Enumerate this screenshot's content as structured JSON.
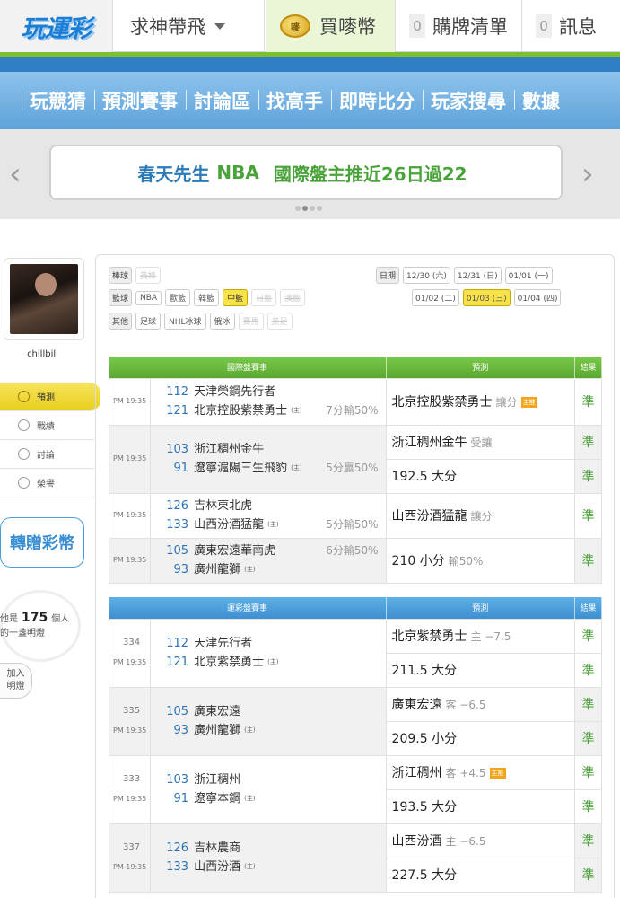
{
  "topbar": {
    "logo": "玩運彩",
    "menu1": "求神帶飛",
    "buy_label": "買嘜幣",
    "coin_label": "嘜",
    "orders_count": "0",
    "orders_label": "購牌清單",
    "msg_count": "0",
    "msg_label": "訊息"
  },
  "nav": [
    "玩競猜",
    "預測賽事",
    "討論區",
    "找高手",
    "即時比分",
    "玩家搜尋",
    "數據"
  ],
  "banner": {
    "left": "春天先生",
    "mid": "NBA",
    "right": "國際盤主推近26日過22",
    "prev": "‹",
    "next": "›"
  },
  "sidebar": {
    "username": "chillbill",
    "menu": [
      "預測",
      "戰績",
      "討論",
      "榮譽"
    ],
    "gift_button": "轉贈彩幣",
    "bulb_prefix": "他是",
    "bulb_count": "175",
    "bulb_suffix": "個人",
    "bulb_line2": "的一盞明燈",
    "join_line1": "加入",
    "join_line2": "明燈"
  },
  "filters": {
    "row1_label": "棒球",
    "row1": [
      "美棒"
    ],
    "row2_label": "籃球",
    "row2": [
      "NBA",
      "歐籃",
      "韓籃",
      "中籃",
      "日籃",
      "澳籃"
    ],
    "row3_label": "其他",
    "row3": [
      "足球",
      "NHL冰球",
      "俄冰",
      "賽馬",
      "美足"
    ],
    "date_label": "日期",
    "dates1": [
      "12/30 (六)",
      "12/31 (日)",
      "01/01 (一)"
    ],
    "dates2": [
      "01/02 (二)",
      "01/03 (三)",
      "01/04 (四)"
    ]
  },
  "intl": {
    "headers": [
      "國際盤賽事",
      "預測",
      "結果"
    ],
    "time": "PM 19:35",
    "home": "(主)",
    "games": [
      {
        "n1": "112",
        "t1": "天津榮鋼先行者",
        "n2": "121",
        "t2": "北京控股紫禁勇士",
        "spread": "7分輸50%",
        "preds": [
          {
            "text": "北京控股紫禁勇士",
            "sub": "讓分",
            "badge": "主推",
            "res": "準"
          }
        ]
      },
      {
        "n1": "103",
        "t1": "浙江稠州金牛",
        "n2": "91",
        "t2": "遼寧滬陽三生飛豹",
        "spread": "5分贏50%",
        "preds": [
          {
            "text": "浙江稠州金牛",
            "sub": "受讓",
            "res": "準"
          },
          {
            "text": "192.5 大分",
            "sub": "",
            "res": "準"
          }
        ]
      },
      {
        "n1": "126",
        "t1": "吉林東北虎",
        "n2": "133",
        "t2": "山西汾酒猛龍",
        "spread": "5分輸50%",
        "preds": [
          {
            "text": "山西汾酒猛龍",
            "sub": "讓分",
            "res": "準"
          }
        ]
      },
      {
        "n1": "105",
        "t1": "廣東宏遠華南虎",
        "n2": "93",
        "t2": "廣州龍獅",
        "spread": "6分輸50%",
        "preds": [
          {
            "text": "210 小分",
            "sub": "輸50%",
            "res": "準"
          }
        ]
      }
    ]
  },
  "lottery": {
    "headers": [
      "運彩盤賽事",
      "預測",
      "結果"
    ],
    "time": "PM 19:35",
    "home": "(主)",
    "games": [
      {
        "id": "334",
        "n1": "112",
        "t1": "天津先行者",
        "n2": "121",
        "t2": "北京紫禁勇士",
        "preds": [
          {
            "text": "北京紫禁勇士",
            "sub": "主 −7.5",
            "res": "準"
          },
          {
            "text": "211.5 大分",
            "sub": "",
            "res": "準"
          }
        ]
      },
      {
        "id": "335",
        "n1": "105",
        "t1": "廣東宏遠",
        "n2": "93",
        "t2": "廣州龍獅",
        "preds": [
          {
            "text": "廣東宏遠",
            "sub": "客 −6.5",
            "res": "準"
          },
          {
            "text": "209.5 小分",
            "sub": "",
            "res": "準"
          }
        ]
      },
      {
        "id": "333",
        "n1": "103",
        "t1": "浙江稠州",
        "n2": "91",
        "t2": "遼寧本鋼",
        "preds": [
          {
            "text": "浙江稠州",
            "sub": "客 +4.5",
            "badge": "主推",
            "res": "準"
          },
          {
            "text": "193.5 大分",
            "sub": "",
            "res": "準"
          }
        ]
      },
      {
        "id": "337",
        "n1": "126",
        "t1": "吉林農商",
        "n2": "133",
        "t2": "山西汾酒",
        "preds": [
          {
            "text": "山西汾酒",
            "sub": "主 −6.5",
            "res": "準"
          },
          {
            "text": "227.5 大分",
            "sub": "",
            "res": "準"
          }
        ]
      }
    ]
  }
}
